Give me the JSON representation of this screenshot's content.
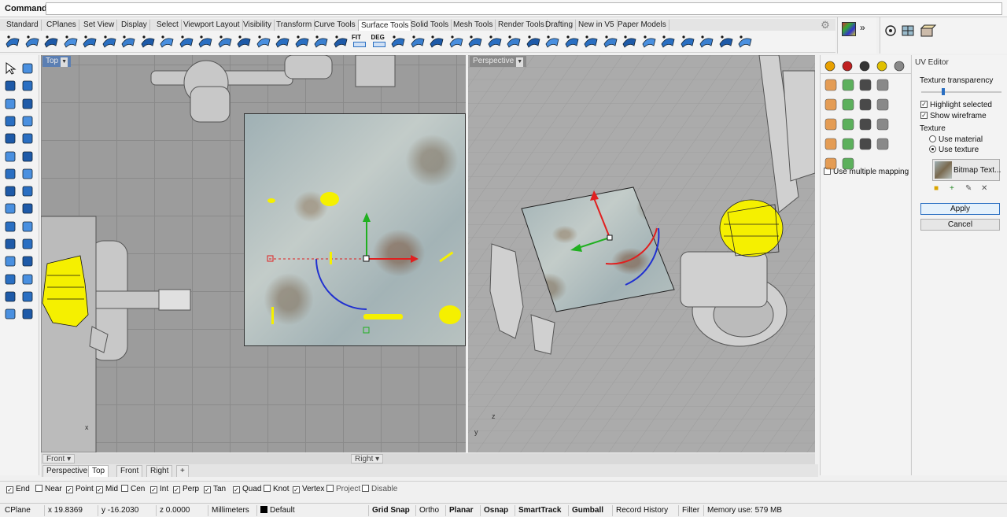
{
  "command": {
    "label": "Command:",
    "value": ""
  },
  "tabs": [
    "Standard",
    "CPlanes",
    "Set View",
    "Display",
    "Select",
    "Viewport Layout",
    "Visibility",
    "Transform",
    "Curve Tools",
    "Surface Tools",
    "Solid Tools",
    "Mesh Tools",
    "Render Tools",
    "Drafting",
    "New in V5",
    "Paper Models"
  ],
  "active_tab": "Surface Tools",
  "toolbar_icons": [
    "surface-from-points-icon",
    "surface-from-curves-icon",
    "edge-surface-icon",
    "planar-surface-icon",
    "loft-icon",
    "sweep1-icon",
    "sweep2-icon",
    "revolve-icon",
    "rail-revolve-icon",
    "extrude-icon",
    "network-icon",
    "patch-icon",
    "drape-icon",
    "heightfield-icon",
    "blend-surface-icon",
    "fillet-surface-icon",
    "offset-surface-icon",
    "extend-surface-icon",
    "fit-icon",
    "deg-icon",
    "rebuild-icon",
    "match-surface-icon",
    "merge-icon",
    "join-icon",
    "untrim-icon",
    "shrink-icon",
    "split-icon",
    "unroll-icon",
    "explode-icon",
    "edge-tools-icon",
    "points-on-icon",
    "points-off-icon",
    "analysis-icon",
    "zebra-icon",
    "emap-icon",
    "curvature-icon",
    "draft-angle-icon",
    "render-color-icon",
    "boolean-icon"
  ],
  "toolbar_labels": {
    "fit": "FIT",
    "deg": "DEG"
  },
  "viewports": {
    "top": {
      "label": "Top"
    },
    "perspective": {
      "label": "Perspective"
    },
    "front_mini": {
      "label": "Front"
    },
    "right_mini": {
      "label": "Right"
    }
  },
  "viewport_tabs": [
    "Perspective",
    "Top",
    "Front",
    "Right"
  ],
  "active_viewport_tab": "Top",
  "uv_editor": {
    "title": "UV Editor",
    "texture_transparency": "Texture transparency",
    "highlight_selected": "Highlight selected",
    "show_wireframe": "Show wireframe",
    "texture": "Texture",
    "use_material": "Use material",
    "use_texture": "Use texture",
    "bitmap": "Bitmap Text...",
    "apply": "Apply",
    "cancel": "Cancel"
  },
  "props_panel": {
    "use_multiple": "Use multiple mapping cha"
  },
  "osnap": [
    {
      "label": "End",
      "checked": true
    },
    {
      "label": "Near",
      "checked": false
    },
    {
      "label": "Point",
      "checked": true
    },
    {
      "label": "Mid",
      "checked": true
    },
    {
      "label": "Cen",
      "checked": false
    },
    {
      "label": "Int",
      "checked": true
    },
    {
      "label": "Perp",
      "checked": true
    },
    {
      "label": "Tan",
      "checked": true
    },
    {
      "label": "Quad",
      "checked": true
    },
    {
      "label": "Knot",
      "checked": false
    },
    {
      "label": "Vertex",
      "checked": true
    },
    {
      "label": "Project",
      "checked": false
    },
    {
      "label": "Disable",
      "checked": false
    }
  ],
  "status": {
    "cplane": "CPlane",
    "x": "x 19.8369",
    "y": "y -16.2030",
    "z": "z 0.0000",
    "units": "Millimeters",
    "layer": "Default",
    "grid_snap": "Grid Snap",
    "ortho": "Ortho",
    "planar": "Planar",
    "osnap": "Osnap",
    "smarttrack": "SmartTrack",
    "gumball": "Gumball",
    "record_history": "Record History",
    "filter": "Filter",
    "memory": "Memory use: 579 MB"
  },
  "colors": {
    "accent": "#2a6fc2",
    "highlight": "#f5f000"
  }
}
